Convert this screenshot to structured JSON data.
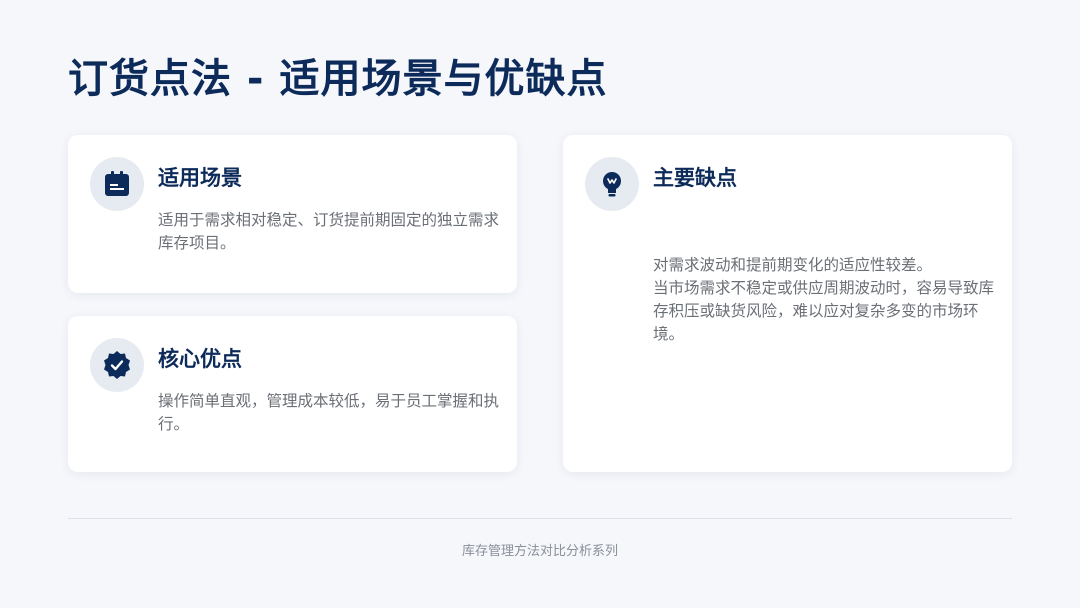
{
  "page": {
    "title": "订货点法 - 适用场景与优缺点"
  },
  "cards": {
    "scenario": {
      "icon": "calendar-icon",
      "title": "适用场景",
      "description": "适用于需求相对稳定、订货提前期固定的独立需求库存项目。"
    },
    "advantage": {
      "icon": "verified-badge-icon",
      "title": "核心优点",
      "description": "操作简单直观，管理成本较低，易于员工掌握和执行。"
    },
    "drawback": {
      "icon": "lightbulb-icon",
      "title": "主要缺点",
      "description_line1": "对需求波动和提前期变化的适应性较差。",
      "description_line2": "当市场需求不稳定或供应周期波动时，容易导致库存积压或缺货风险，难以应对复杂多变的市场环境。"
    }
  },
  "footer": {
    "text": "库存管理方法对比分析系列"
  },
  "colors": {
    "background": "#f5f7fb",
    "accent": "#0d2b5a",
    "icon_bg": "#e6ebf2",
    "body_text": "#6b6f76"
  }
}
